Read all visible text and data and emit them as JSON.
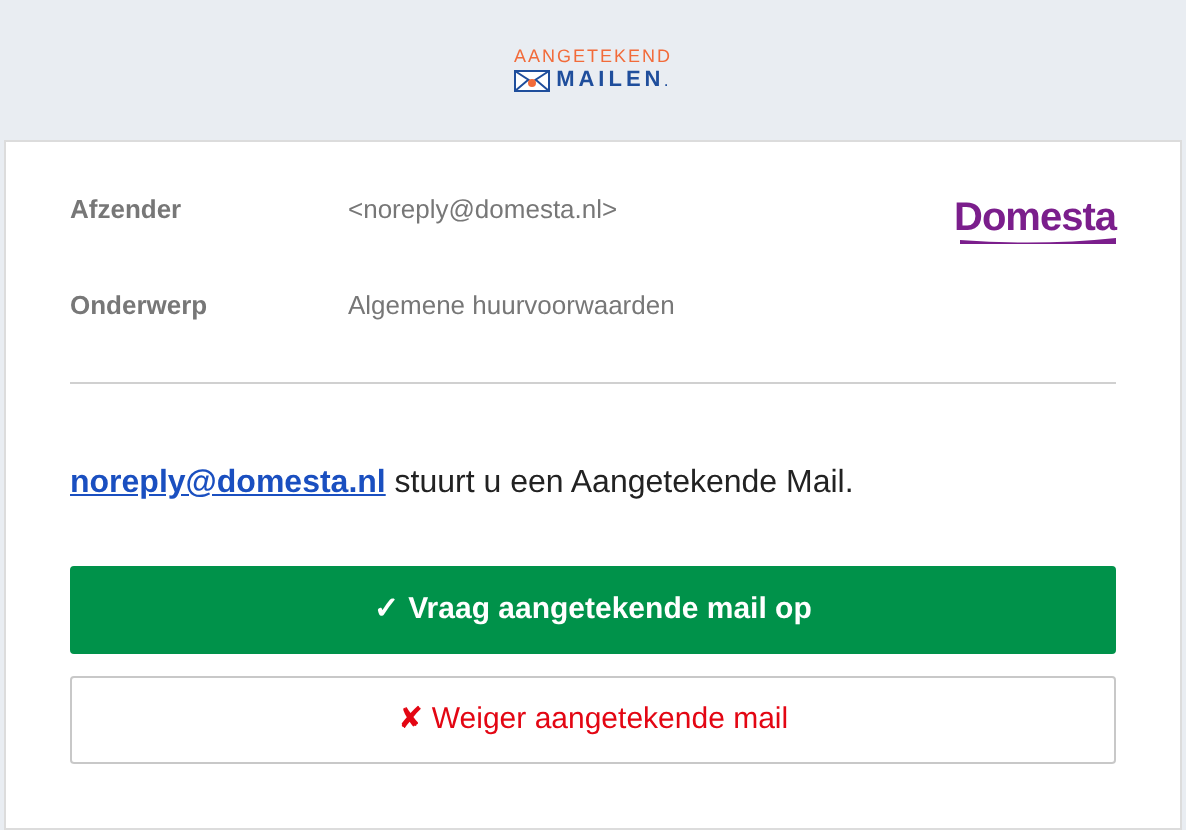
{
  "header": {
    "logo_top": "AANGETEKEND",
    "logo_bottom": "MAILEN",
    "logo_mark": "."
  },
  "details": [
    {
      "label": "Afzender",
      "value": "<noreply@domesta.nl>"
    },
    {
      "label": "Onderwerp",
      "value": "Algemene huurvoorwaarden"
    }
  ],
  "sender_logo": "Domesta",
  "message": {
    "link": "noreply@domesta.nl",
    "text": " stuurt u een Aangetekende Mail."
  },
  "buttons": [
    {
      "kind": "primary",
      "icon": "✓",
      "label": "Vraag aangetekende mail op"
    },
    {
      "kind": "secondary",
      "icon": "✘",
      "label": "Weiger aangetekende mail"
    }
  ]
}
